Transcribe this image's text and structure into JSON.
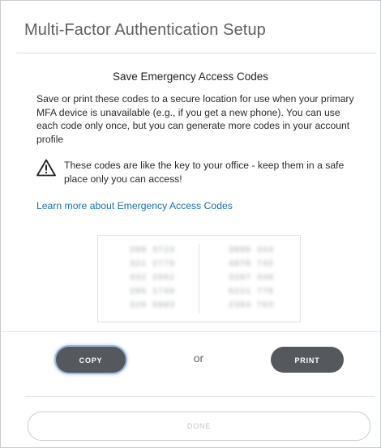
{
  "dialog": {
    "title": "Multi-Factor Authentication Setup"
  },
  "content": {
    "heading": "Save Emergency Access Codes",
    "description": "Save or print these codes to a secure location for use when your primary MFA device is unavailable (e.g., if you get a new phone). You can use each code only once, but you can generate more codes in your account profile",
    "warning_icon": "warning-triangle-icon",
    "warning_text": "These codes are like the key to your office - keep them in a safe place only you can access!",
    "learn_more_link": "Learn more about Emergency Access Codes"
  },
  "codes": {
    "left": [
      "298 3723",
      "321 2779",
      "332 2562",
      "286 1749",
      "329 5883"
    ],
    "right": [
      "3886 344",
      "4876 742",
      "3287 346",
      "6221 776",
      "2384 763"
    ]
  },
  "actions": {
    "copy_label": "COPY",
    "or_label": "or",
    "print_label": "PRINT",
    "done_label": "DONE"
  },
  "colors": {
    "button_dark": "#55585d",
    "link": "#1a6fb5",
    "focus_ring": "#9bb8d8"
  }
}
